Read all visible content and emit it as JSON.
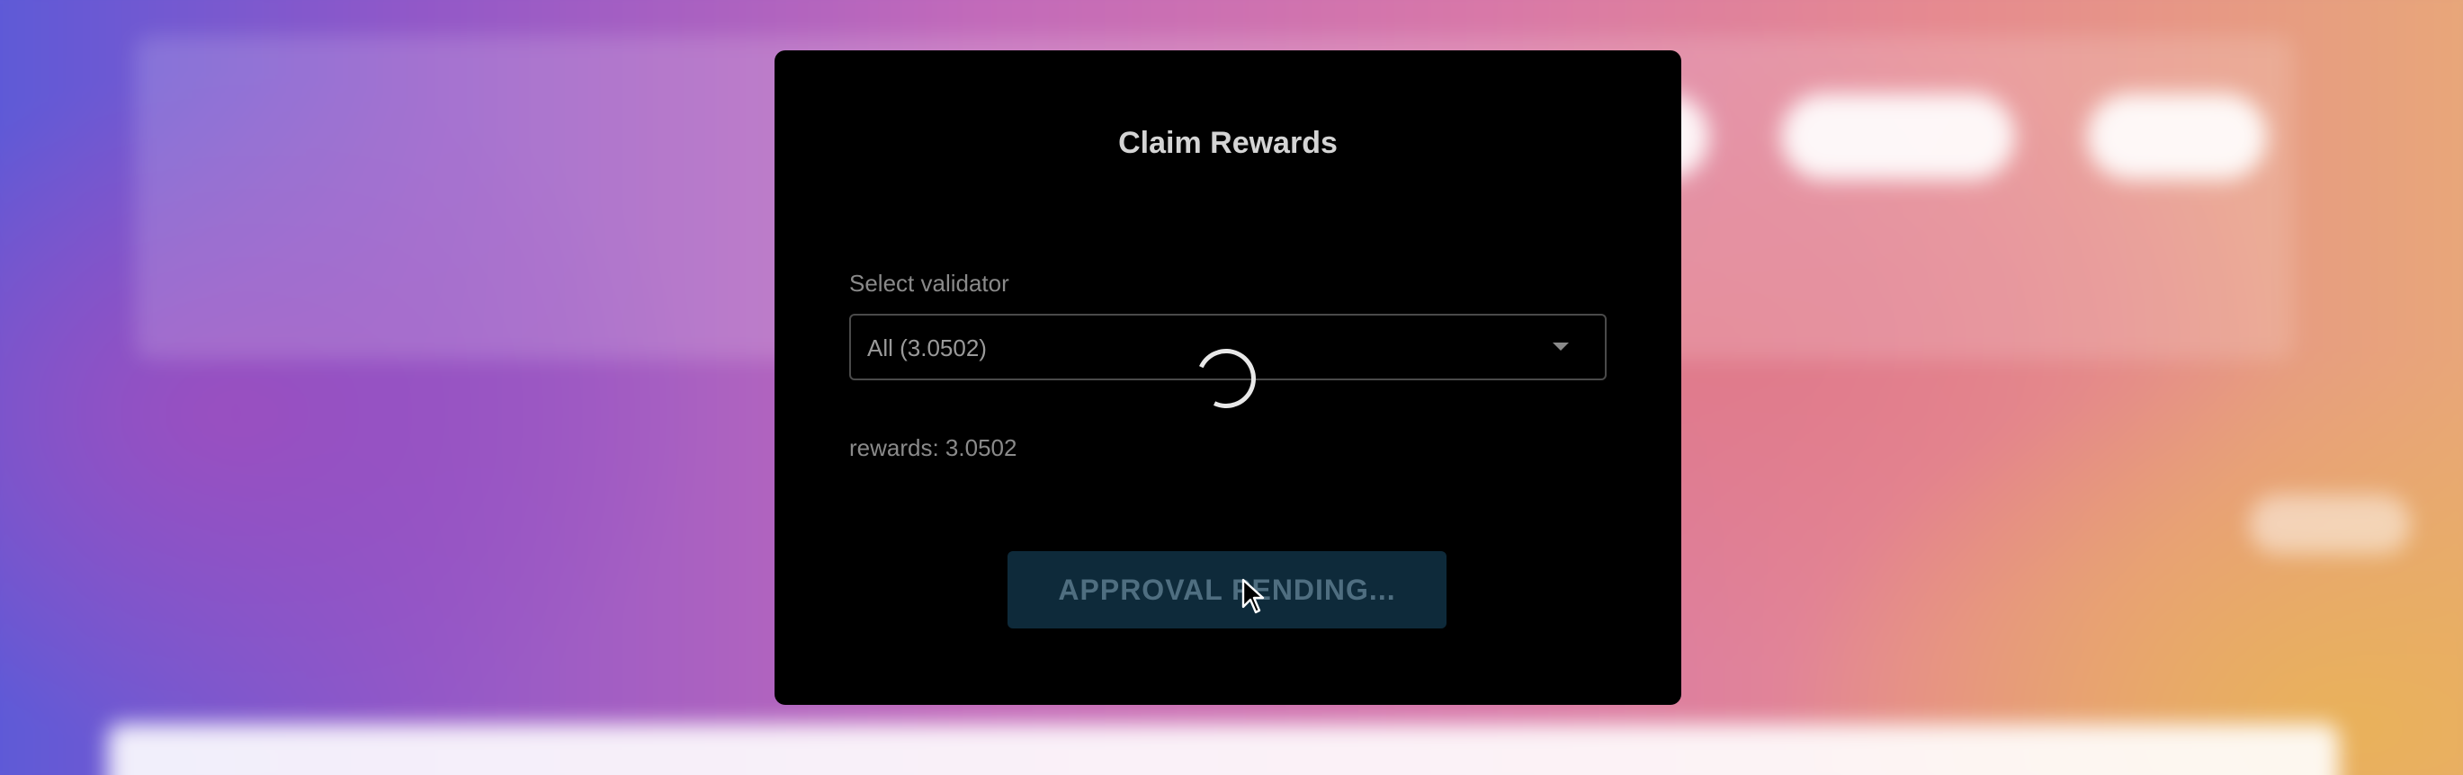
{
  "modal": {
    "title": "Claim Rewards",
    "select_label": "Select validator",
    "select_value": "All (3.0502)",
    "rewards_text": "rewards: 3.0502",
    "approve_button_label": "APPROVAL PENDING..."
  },
  "colors": {
    "modal_background": "#000000",
    "button_background": "#0e2a3a",
    "button_text": "#4f6e80",
    "spinner": "#e8e8e8"
  },
  "icons": {
    "select_caret": "chevron-down-icon",
    "loading": "spinner-icon",
    "pointer": "mouse-cursor-icon"
  }
}
